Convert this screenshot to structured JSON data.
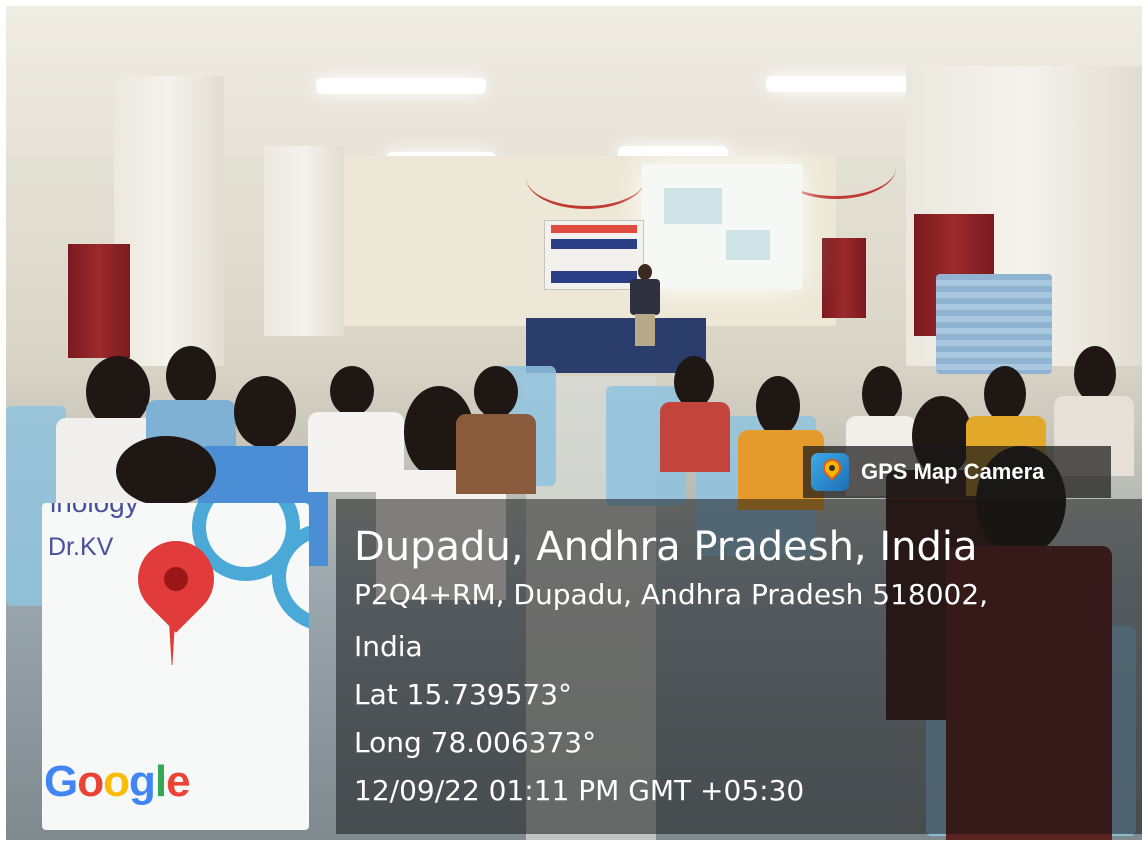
{
  "app_badge": {
    "name": "GPS Map Camera",
    "icon": "gps-map-camera-icon"
  },
  "map": {
    "label_top": "inology",
    "label_kv": "Dr.KV",
    "logo_letters": [
      "G",
      "o",
      "o",
      "g",
      "l",
      "e"
    ],
    "logo_colors": [
      "#4285F4",
      "#EA4335",
      "#FBBC05",
      "#4285F4",
      "#34A853",
      "#EA4335"
    ],
    "pin_icon": "location-pin-icon"
  },
  "location": {
    "title": "Dupadu, Andhra Pradesh, India",
    "address_line1": "P2Q4+RM, Dupadu, Andhra Pradesh 518002,",
    "address_line2": "India",
    "latitude": "Lat 15.739573°",
    "longitude": "Long 78.006373°",
    "datetime": "12/09/22 01:11 PM GMT +05:30"
  }
}
